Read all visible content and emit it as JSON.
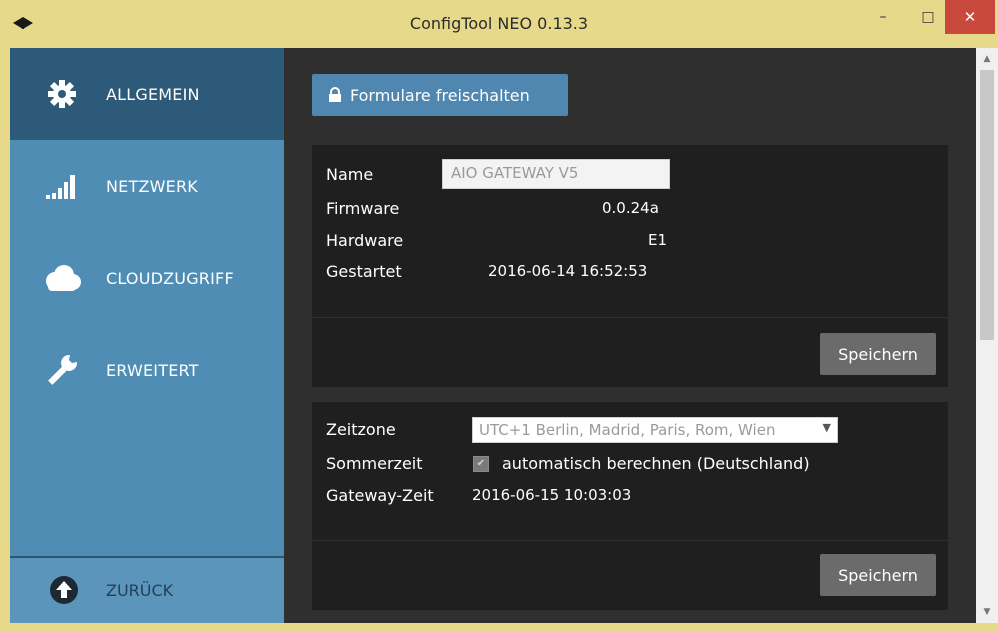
{
  "window": {
    "title": "ConfigTool NEO 0.13.3",
    "controls": {
      "minimize": "–",
      "maximize": "□",
      "close": "✕"
    }
  },
  "sidebar": {
    "items": [
      {
        "label": "ALLGEMEIN",
        "icon": "gear-icon",
        "active": true
      },
      {
        "label": "NETZWERK",
        "icon": "signal-bars-icon",
        "active": false
      },
      {
        "label": "CLOUDZUGRIFF",
        "icon": "cloud-icon",
        "active": false
      },
      {
        "label": "ERWEITERT",
        "icon": "wrench-icon",
        "active": false
      }
    ],
    "back": {
      "label": "ZURÜCK",
      "icon": "arrow-up-circle-icon"
    }
  },
  "main": {
    "unlock_button": {
      "label": "Formulare freischalten",
      "icon": "lock-icon"
    },
    "device_panel": {
      "name_label": "Name",
      "name_value": "AIO GATEWAY V5",
      "firmware_label": "Firmware",
      "firmware_value": "0.0.24a",
      "hardware_label": "Hardware",
      "hardware_value": "E1",
      "started_label": "Gestartet",
      "started_value": "2016-06-14 16:52:53",
      "save_label": "Speichern"
    },
    "time_panel": {
      "timezone_label": "Zeitzone",
      "timezone_value": "UTC+1  Berlin, Madrid, Paris, Rom, Wien",
      "dst_label": "Sommerzeit",
      "dst_checkbox_label": "automatisch berechnen (Deutschland)",
      "dst_checked": true,
      "gateway_time_label": "Gateway-Zeit",
      "gateway_time_value": "2016-06-15 10:03:03",
      "save_label": "Speichern"
    }
  },
  "colors": {
    "titlebar": "#e6d98a",
    "sidebar": "#4f8db5",
    "sidebar_active": "#2c5a78",
    "content_bg": "#2f2f2f",
    "panel_bg": "#1f1f1f",
    "accent_button": "#4f87b1",
    "save_button": "#6b6b6b",
    "close_button": "#c94a3d"
  }
}
